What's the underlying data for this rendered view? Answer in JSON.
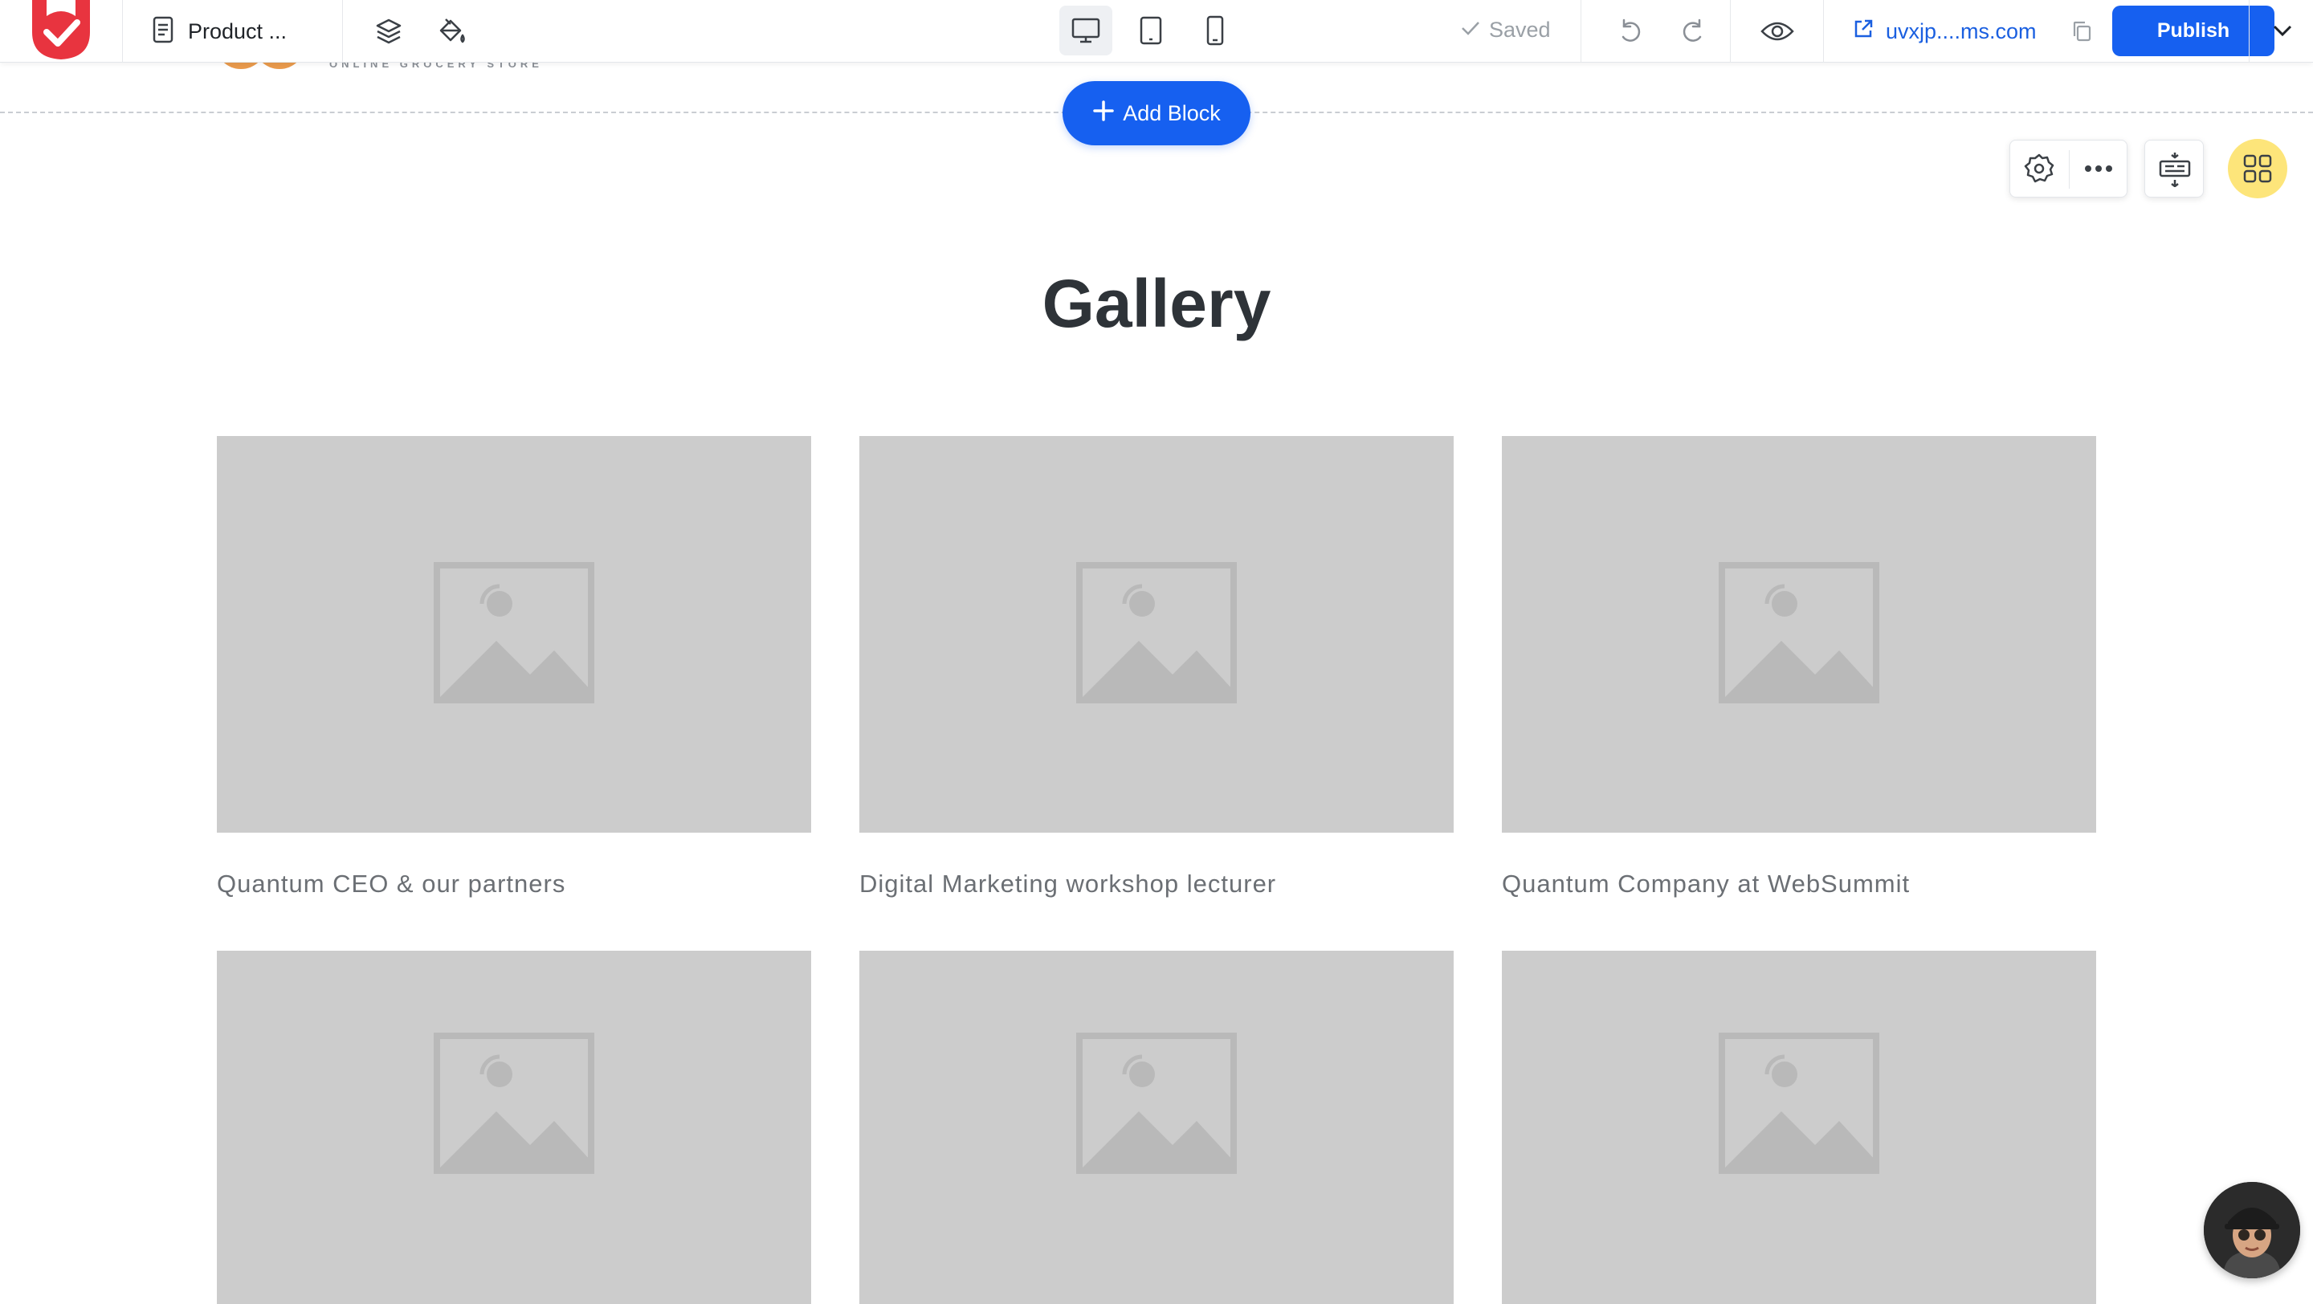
{
  "toolbar": {
    "page_name": "Product ...",
    "saved_label": "Saved",
    "domain_text": "uvxjp....ms.com",
    "publish_label": "Publish",
    "device_active": "desktop",
    "icons": [
      "logo-icon",
      "page-icon",
      "layers-icon",
      "paint-bucket-icon",
      "desktop-icon",
      "tablet-icon",
      "mobile-icon",
      "check-icon",
      "undo-icon",
      "redo-icon",
      "eye-icon",
      "external-link-icon",
      "copy-icon",
      "chevron-down-icon"
    ]
  },
  "canvas": {
    "prev_block_subtitle": "ONLINE GROCERY STORE",
    "add_block_label": "Add Block",
    "block_tool_icons": [
      "gear-icon",
      "more-icon",
      "layout-icon",
      "apps-grid-icon"
    ]
  },
  "gallery": {
    "title": "Gallery",
    "items": [
      {
        "caption": "Quantum CEO & our partners"
      },
      {
        "caption": "Digital Marketing workshop lecturer"
      },
      {
        "caption": "Quantum Company at WebSummit"
      },
      {
        "caption": ""
      },
      {
        "caption": ""
      },
      {
        "caption": ""
      }
    ]
  },
  "colors": {
    "accent": "#1660f0",
    "logo": "#e8343f",
    "placeholder": "#cccccc",
    "apps_button": "#fde57a"
  }
}
